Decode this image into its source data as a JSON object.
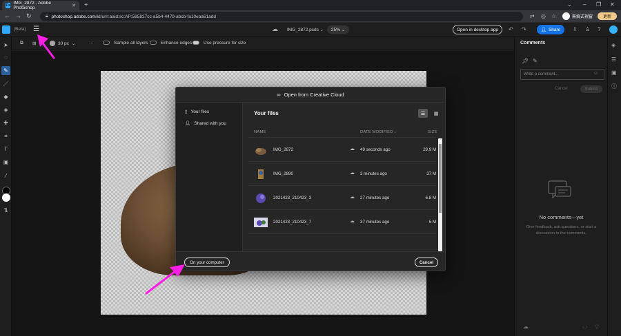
{
  "browser": {
    "tab_title": "IMG_2872 - Adobe Photoshop",
    "tab_favicon": "Ps",
    "url_host": "photoshop.adobe.com",
    "url_path": "/id/urn:aaid:sc:AP:585827cc-a5b4-4479-abcb-fa10eaa61add",
    "profile_name": "無痕式視窗",
    "update_label": "更新"
  },
  "app": {
    "beta_label": "(Beta)",
    "doc_name": "IMG_2872.psds",
    "zoom": "25%",
    "open_desktop_label": "Open in desktop app",
    "share_label": "Share"
  },
  "options": {
    "brush_size": "30 px",
    "sample_all_layers": "Sample all layers",
    "enhance_edges": "Enhance edges",
    "use_pressure": "Use pressure for size"
  },
  "comments": {
    "title": "Comments",
    "placeholder": "Write a comment...",
    "cancel": "Cancel",
    "submit": "Submit",
    "empty_title": "No comments—yet",
    "empty_desc": "Give feedback, ask questions, or start a discussion in the comments."
  },
  "dialog": {
    "title": "Open from Creative Cloud",
    "nav": [
      {
        "label": "Your files"
      },
      {
        "label": "Shared with you"
      }
    ],
    "section_title": "Your files",
    "columns": {
      "name": "NAME",
      "modified": "DATE MODIFIED",
      "size": "SIZE"
    },
    "files": [
      {
        "name": "IMG_2872",
        "modified": "49 seconds ago",
        "size": "29.9 M"
      },
      {
        "name": "IMG_2890",
        "modified": "3 minutes ago",
        "size": "37 M"
      },
      {
        "name": "2021423_210423_3",
        "modified": "27 minutes ago",
        "size": "6.8 M"
      },
      {
        "name": "2021423_210423_7",
        "modified": "37 minutes ago",
        "size": "5 M"
      }
    ],
    "on_computer_label": "On your computer",
    "cancel_label": "Cancel"
  },
  "colors": {
    "annotation": "#ff1ee6",
    "accent": "#1473e6"
  }
}
